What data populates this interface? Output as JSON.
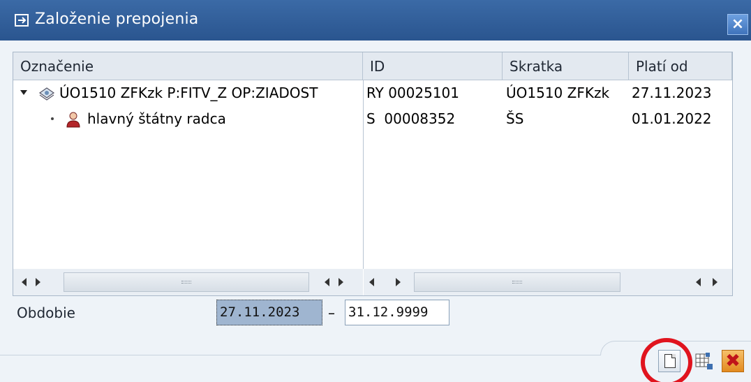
{
  "window": {
    "title": "Založenie prepojenia",
    "close_label": "×"
  },
  "grid": {
    "columns": [
      "Označenie",
      "ID",
      "Skratka",
      "Platí od"
    ],
    "rows": [
      {
        "level": 0,
        "expanded": true,
        "icon": "org-unit-icon",
        "oznacenie": "ÚO1510 ZFKzk P:FITV_Z OP:ZIADOST",
        "id": "RY 00025101",
        "skratka": "ÚO1510 ZFKzk",
        "plati_od": "27.11.2023"
      },
      {
        "level": 1,
        "expanded": false,
        "icon": "person-icon",
        "oznacenie": "hlavný štátny radca",
        "id": "S  00008352",
        "skratka": "ŠS",
        "plati_od": "01.01.2022"
      }
    ]
  },
  "period": {
    "label": "Obdobie",
    "from": "27.11.2023",
    "separator": "–",
    "to": "31.12.9999"
  },
  "toolbar": {
    "cancel_label": "✖"
  },
  "colors": {
    "title_bar": "#2f5e9c",
    "highlight_ring": "#e0141e",
    "selected_field": "#9fb5d0"
  }
}
